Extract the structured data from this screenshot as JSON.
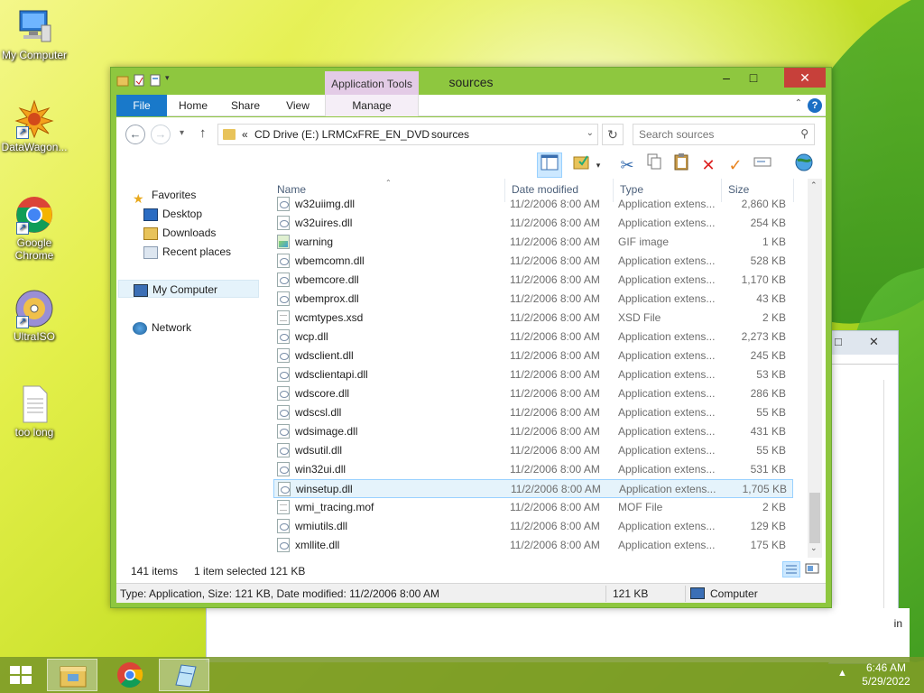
{
  "desktop": {
    "icons": [
      {
        "label": "My Computer",
        "icon": "computer-icon"
      },
      {
        "label": "DataWagon...",
        "icon": "datawagon-icon"
      },
      {
        "label": "Google Chrome",
        "icon": "chrome-icon"
      },
      {
        "label": "UltraISO",
        "icon": "disc-icon"
      },
      {
        "label": "too long",
        "icon": "text-file-icon"
      }
    ],
    "back_window_text": "in"
  },
  "window": {
    "title": "sources",
    "contextual_tab_group": "Application Tools",
    "tabs": [
      "File",
      "Home",
      "Share",
      "View",
      "Manage"
    ],
    "address": {
      "overflow": "«",
      "crumbs": [
        "CD Drive (E:) LRMCxFRE_EN_DVD",
        "sources"
      ]
    },
    "search_placeholder": "Search sources",
    "navigation": {
      "favorites": "Favorites",
      "favorites_items": [
        "Desktop",
        "Downloads",
        "Recent places"
      ],
      "computer": "My Computer",
      "network": "Network"
    },
    "columns": {
      "name": "Name",
      "date": "Date modified",
      "type": "Type",
      "size": "Size"
    },
    "files": [
      {
        "name": "w32uiimg.dll",
        "date": "11/2/2006 8:00 AM",
        "type": "Application extens...",
        "size": "2,860 KB",
        "kind": "dll"
      },
      {
        "name": "w32uires.dll",
        "date": "11/2/2006 8:00 AM",
        "type": "Application extens...",
        "size": "254 KB",
        "kind": "dll"
      },
      {
        "name": "warning",
        "date": "11/2/2006 8:00 AM",
        "type": "GIF image",
        "size": "1 KB",
        "kind": "gif"
      },
      {
        "name": "wbemcomn.dll",
        "date": "11/2/2006 8:00 AM",
        "type": "Application extens...",
        "size": "528 KB",
        "kind": "dll"
      },
      {
        "name": "wbemcore.dll",
        "date": "11/2/2006 8:00 AM",
        "type": "Application extens...",
        "size": "1,170 KB",
        "kind": "dll"
      },
      {
        "name": "wbemprox.dll",
        "date": "11/2/2006 8:00 AM",
        "type": "Application extens...",
        "size": "43 KB",
        "kind": "dll"
      },
      {
        "name": "wcmtypes.xsd",
        "date": "11/2/2006 8:00 AM",
        "type": "XSD File",
        "size": "2 KB",
        "kind": "txt"
      },
      {
        "name": "wcp.dll",
        "date": "11/2/2006 8:00 AM",
        "type": "Application extens...",
        "size": "2,273 KB",
        "kind": "dll"
      },
      {
        "name": "wdsclient.dll",
        "date": "11/2/2006 8:00 AM",
        "type": "Application extens...",
        "size": "245 KB",
        "kind": "dll"
      },
      {
        "name": "wdsclientapi.dll",
        "date": "11/2/2006 8:00 AM",
        "type": "Application extens...",
        "size": "53 KB",
        "kind": "dll"
      },
      {
        "name": "wdscore.dll",
        "date": "11/2/2006 8:00 AM",
        "type": "Application extens...",
        "size": "286 KB",
        "kind": "dll"
      },
      {
        "name": "wdscsl.dll",
        "date": "11/2/2006 8:00 AM",
        "type": "Application extens...",
        "size": "55 KB",
        "kind": "dll"
      },
      {
        "name": "wdsimage.dll",
        "date": "11/2/2006 8:00 AM",
        "type": "Application extens...",
        "size": "431 KB",
        "kind": "dll"
      },
      {
        "name": "wdsutil.dll",
        "date": "11/2/2006 8:00 AM",
        "type": "Application extens...",
        "size": "55 KB",
        "kind": "dll"
      },
      {
        "name": "win32ui.dll",
        "date": "11/2/2006 8:00 AM",
        "type": "Application extens...",
        "size": "531 KB",
        "kind": "dll"
      },
      {
        "name": "winsetup.dll",
        "date": "11/2/2006 8:00 AM",
        "type": "Application extens...",
        "size": "1,705 KB",
        "kind": "dll",
        "selected": true
      },
      {
        "name": "wmi_tracing.mof",
        "date": "11/2/2006 8:00 AM",
        "type": "MOF File",
        "size": "2 KB",
        "kind": "txt"
      },
      {
        "name": "wmiutils.dll",
        "date": "11/2/2006 8:00 AM",
        "type": "Application extens...",
        "size": "129 KB",
        "kind": "dll"
      },
      {
        "name": "xmllite.dll",
        "date": "11/2/2006 8:00 AM",
        "type": "Application extens...",
        "size": "175 KB",
        "kind": "dll"
      }
    ],
    "item_count": "141 items",
    "selection_info": "1 item selected  121 KB",
    "statusbar": {
      "details": "Type: Application, Size: 121 KB, Date modified: 11/2/2006 8:00 AM",
      "size": "121 KB",
      "location": "Computer"
    }
  },
  "taskbar": {
    "time": "6:46 AM",
    "date": "5/29/2022"
  },
  "colors": {
    "window_frame": "#8ec73f",
    "file_tab": "#1979ca",
    "context_tab": "#e3cbe6",
    "close_button": "#c7403a",
    "selection": "#e5f3fb"
  }
}
